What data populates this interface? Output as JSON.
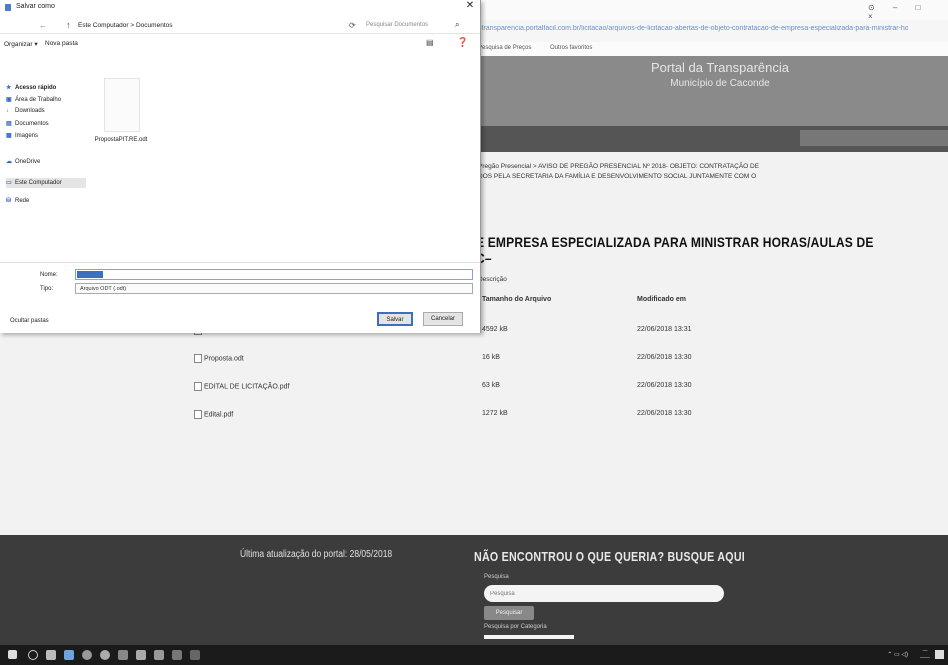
{
  "browser": {
    "address": "stransparencia.portalfacil.com.br/licitacao/arquivos-de-licitacao-abertas-de-objeto-contratacao-de-empresa-especializada-para-ministrar-horas-aulas-de-capoeira",
    "bookmarks": [
      "Pesquisa de Preços",
      "Outros favoritos"
    ]
  },
  "portal": {
    "title": "Portal da Transparência",
    "subtitle": "Município de Caconde"
  },
  "breadcrumb": {
    "line1": "Pregão Presencial > AVISO DE PREGÃO PRESENCIAL Nº 2018- OBJETO: CONTRATAÇÃO DE",
    "line2": "DOS PELA SECRETARIA DA FAMÍLIA E DESENVOLVIMENTO SOCIAL JUNTAMENTE COM O"
  },
  "page": {
    "heading": "E EMPRESA ESPECIALIZADA PARA MINISTRAR HORAS/AULAS DE C–",
    "desc_label": "Descrição"
  },
  "table": {
    "headers": {
      "size": "Tamanho do Arquivo",
      "modified": "Modificado em"
    },
    "rows": [
      {
        "name": "",
        "size": "4592 kB",
        "modified": "22/06/2018 13:31"
      },
      {
        "name": "Proposta.odt",
        "size": "16 kB",
        "modified": "22/06/2018 13:30"
      },
      {
        "name": "EDITAL DE LICITAÇÃO.pdf",
        "size": "63 kB",
        "modified": "22/06/2018 13:30"
      },
      {
        "name": "Edital.pdf",
        "size": "1272 kB",
        "modified": "22/06/2018 13:30"
      }
    ]
  },
  "footer": {
    "update": "Última atualização do portal: 28/05/2018",
    "search_title": "NÃO ENCONTROU O QUE QUERIA? BUSQUE AQUI",
    "pesquisa_label": "Pesquisa",
    "input_placeholder": "Pesquisa",
    "button_label": "Pesquisar",
    "category_label": "Pesquisa por Categoria"
  },
  "dialog": {
    "title": "Salvar como",
    "path": "Este Computador  >  Documentos",
    "search_placeholder": "Pesquisar Documentos",
    "organize": "Organizar ▾",
    "new_folder": "Nova pasta",
    "nav": [
      {
        "label": "Acesso rápido",
        "icon": "star-icon"
      },
      {
        "label": "Área de Trabalho",
        "icon": "desktop-icon"
      },
      {
        "label": "Downloads",
        "icon": "download-icon"
      },
      {
        "label": "Documentos",
        "icon": "document-icon"
      },
      {
        "label": "Imagens",
        "icon": "image-icon"
      },
      {
        "label": "OneDrive",
        "icon": "cloud-icon"
      },
      {
        "label": "Este Computador",
        "icon": "computer-icon"
      },
      {
        "label": "Rede",
        "icon": "network-icon"
      }
    ],
    "file_name": "PropostaPIT.RE.odt",
    "name_label": "Nome:",
    "type_label": "Tipo:",
    "type_value": "Arquivo ODT (.odt)",
    "hide_folders": "Ocultar pastas",
    "save_label": "Salvar",
    "cancel_label": "Cancelar"
  },
  "colors": {
    "accent": "#3c6fbf",
    "footer_bg": "#3c3c3c",
    "taskbar_bg": "#1b1b1b"
  }
}
